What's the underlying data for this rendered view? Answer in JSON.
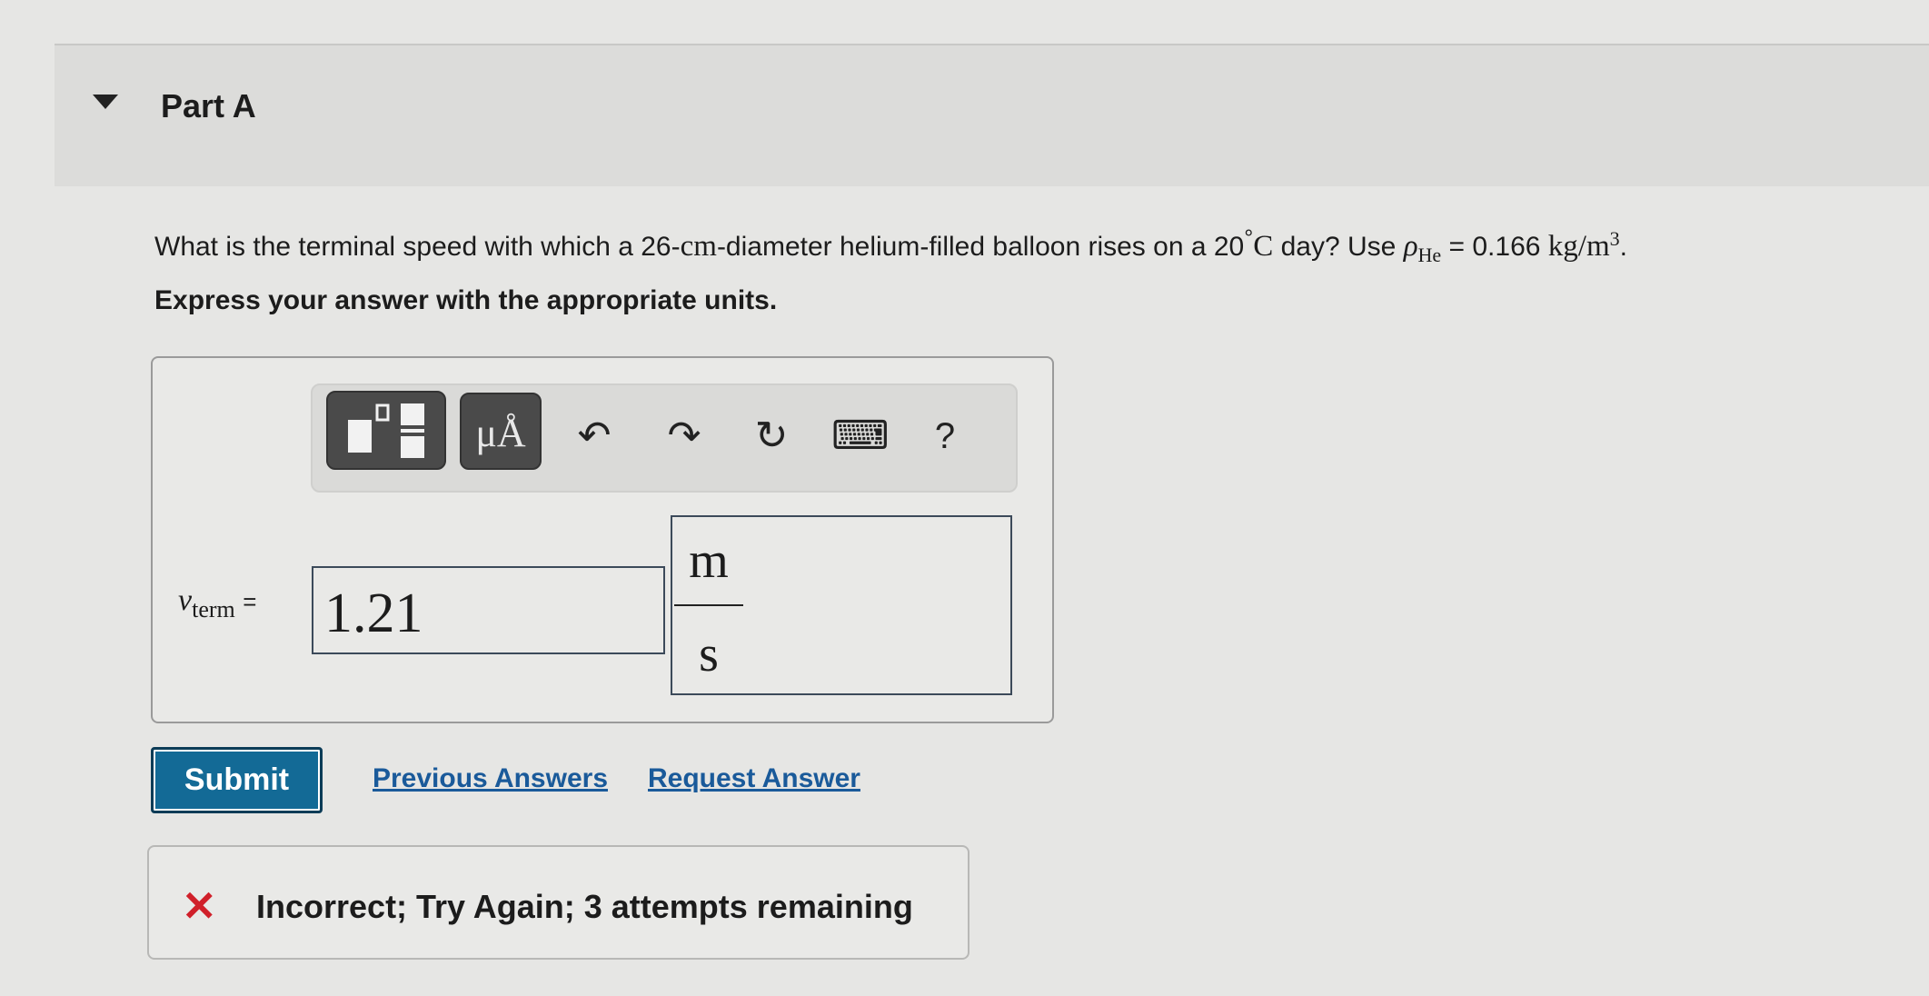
{
  "part": {
    "title": "Part A"
  },
  "question": {
    "text_before": "What is the terminal speed with which a 26-",
    "unit_cm": "cm",
    "text_mid": "-diameter helium-filled balloon rises on a 20",
    "degree": "°",
    "unit_c": "C",
    "text_after": " day? Use ",
    "rho": "ρ",
    "rho_sub": "He",
    "equals_value": " = 0.166 ",
    "density_unit": "kg/m",
    "density_exp": "3",
    "period": "."
  },
  "instructions": "Express your answer with the appropriate units.",
  "toolbar": {
    "units_label": "μÅ",
    "undo": "↶",
    "redo": "↷",
    "reset": "↻",
    "keyboard": "⌨",
    "help": "?"
  },
  "answer": {
    "variable": "v",
    "variable_sub": "term",
    "equals": "=",
    "value": "1.21",
    "unit_numerator": "m",
    "unit_denominator": "s"
  },
  "actions": {
    "submit": "Submit",
    "previous_answers": "Previous Answers",
    "request_answer": "Request Answer"
  },
  "feedback": {
    "icon": "✕",
    "text": "Incorrect; Try Again; 3 attempts remaining",
    "color": "#d0202a"
  }
}
